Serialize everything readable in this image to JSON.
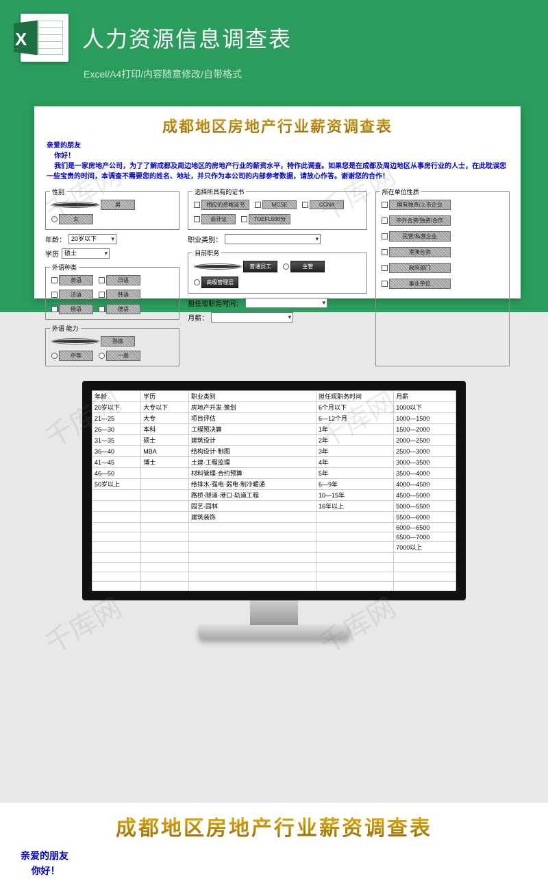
{
  "page": {
    "title": "人力资源信息调查表",
    "subtitle": "Excel/A4打印/内容随意修改/自带格式"
  },
  "form": {
    "title": "成都地区房地产行业薪资调查表",
    "greet1": "亲爱的朋友",
    "greet2": "你好！",
    "intro": "我们是一家房地产公司，为了了解成都及周边地区的房地产行业的薪资水平，特作此调查。如果您是在成都及周边地区从事房行业的人士，在此耽误您一些宝贵的时间，本调查不需要您的姓名、地址，并只作为本公司的内部参考数据，请放心作答。谢谢您的合作！",
    "gender": {
      "legend": "性别",
      "opts": [
        "男",
        "女"
      ]
    },
    "age": {
      "label": "年龄：",
      "value": "20岁以下"
    },
    "edu": {
      "label": "学历",
      "value": "硕士"
    },
    "lang": {
      "legend": "外语种类",
      "opts": [
        "英语",
        "日语",
        "法语",
        "韩语",
        "俄语",
        "德语"
      ]
    },
    "ability": {
      "legend": "外语 能力",
      "opts": [
        "熟练",
        "中等",
        "一般"
      ]
    },
    "cert": {
      "legend": "选择所具有的证书",
      "opts": [
        "相应的资格证书",
        "MCSE",
        "CCNA",
        "会计证",
        "TOEFL500分"
      ]
    },
    "jobcat": {
      "label": "职业类别：",
      "value": ""
    },
    "pos": {
      "legend": "目前职务",
      "opts": [
        "普通员工",
        "主管",
        "高级管理层"
      ]
    },
    "tenure": {
      "label": "担任现职务时间：",
      "value": ""
    },
    "salary": {
      "label": "月薪：",
      "value": ""
    },
    "unit": {
      "legend": "所在单位性质",
      "opts": [
        "国有独资/上市企业",
        "中外合资/独资/合作",
        "民营/私营企业",
        "港澳台资",
        "政府部门",
        "事业单位"
      ]
    }
  },
  "table": {
    "headers": [
      "年龄",
      "学历",
      "职业类别",
      "担任现职务时间",
      "月薪"
    ],
    "rows": [
      [
        "20岁以下",
        "大专以下",
        "房地产开发·策划",
        "6个月以下",
        "1000以下"
      ],
      [
        "21—25",
        "大专",
        "项目评估",
        "6—12个月",
        "1000—1500"
      ],
      [
        "26—30",
        "本科",
        "工程预决算",
        "1年",
        "1500—2000"
      ],
      [
        "31—35",
        "硕士",
        "建筑设计",
        "2年",
        "2000—2500"
      ],
      [
        "36—40",
        "MBA",
        "结构设计·制图",
        "3年",
        "2500—3000"
      ],
      [
        "41—45",
        "博士",
        "土建·工程监理",
        "4年",
        "3000—3500"
      ],
      [
        "46—50",
        "",
        "材料管理·合约预算",
        "5年",
        "3500—4000"
      ],
      [
        "50岁以上",
        "",
        "给排水·强电·弱电·制冷暖通",
        "6—9年",
        "4000—4500"
      ],
      [
        "",
        "",
        "路桥·隧道·港口·轨道工程",
        "10—15年",
        "4500—5000"
      ],
      [
        "",
        "",
        "园艺·园林",
        "16年以上",
        "5000—5500"
      ],
      [
        "",
        "",
        "建筑装饰",
        "",
        "5500—6000"
      ],
      [
        "",
        "",
        "",
        "",
        "6000—6500"
      ],
      [
        "",
        "",
        "",
        "",
        "6500—7000"
      ],
      [
        "",
        "",
        "",
        "",
        "7000以上"
      ]
    ]
  },
  "watermark": "千库网"
}
